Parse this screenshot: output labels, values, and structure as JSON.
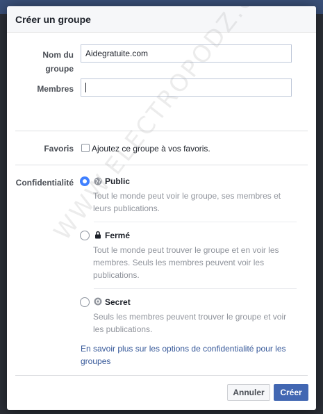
{
  "dialog": {
    "title": "Créer un groupe"
  },
  "form": {
    "group_name_label": "Nom du groupe",
    "group_name_value": "Aidegratuite.com",
    "members_label": "Membres",
    "members_value": "",
    "favorites_label": "Favoris",
    "favorites_checkbox_label": "Ajoutez ce groupe à vos favoris.",
    "favorites_checked": false,
    "privacy_label": "Confidentialité",
    "privacy_options": [
      {
        "title": "Public",
        "icon": "globe-icon",
        "selected": true,
        "description": "Tout le monde peut voir le groupe, ses membres et leurs publications."
      },
      {
        "title": "Fermé",
        "icon": "lock-icon",
        "selected": false,
        "description": "Tout le monde peut trouver le groupe et en voir les membres. Seuls les membres peuvent voir les publications."
      },
      {
        "title": "Secret",
        "icon": "shield-icon",
        "selected": false,
        "description": "Seuls les membres peuvent trouver le groupe et voir les publications."
      }
    ],
    "learn_more_link": "En savoir plus sur les options de confidentialité pour les groupes"
  },
  "footer": {
    "cancel_label": "Annuler",
    "create_label": "Créer"
  },
  "watermark": "WWW.ELECTROPODZ.COM",
  "colors": {
    "primary": "#4267b2",
    "radio_selected": "#4080ff",
    "link": "#365899",
    "label": "#4b4f56",
    "muted": "#90949c"
  }
}
